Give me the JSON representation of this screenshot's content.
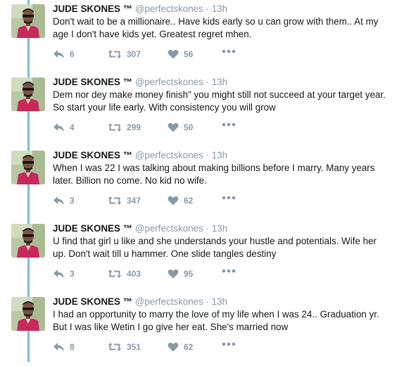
{
  "colors": {
    "thread_line": "#7fb8de",
    "meta": "#8899a6",
    "avatar_shirt": "#c8285a"
  },
  "tweets": [
    {
      "name": "JUDE SKONES ™",
      "handle": "@perfectskones",
      "sep": "·",
      "time": "13h",
      "lines": [
        "Don't wait to be a millionaire..  Have kids early so u can grow with them..  At my",
        "age I don't have kids yet.  Greatest regret mhen."
      ],
      "replies": "6",
      "retweets": "307",
      "likes": "56"
    },
    {
      "name": "JUDE SKONES ™",
      "handle": "@perfectskones",
      "sep": "·",
      "time": "13h",
      "lines": [
        "Dem nor dey make money finish\" you might still not succeed at your target year.",
        "So start your life early.  With consistency you will grow"
      ],
      "replies": "4",
      "retweets": "299",
      "likes": "50"
    },
    {
      "name": "JUDE SKONES ™",
      "handle": "@perfectskones",
      "sep": "·",
      "time": "13h",
      "lines": [
        "When I was 22 I was talking about making billions before I marry.  Many years",
        "later.  Billion no come.  No kid no wife."
      ],
      "replies": "3",
      "retweets": "347",
      "likes": "62"
    },
    {
      "name": "JUDE SKONES ™",
      "handle": "@perfectskones",
      "sep": "·",
      "time": "13h",
      "lines": [
        "U find that girl u like and she understands your hustle and potentials.  Wife her",
        "up.   Don't wait till u hammer.  One slide tangles destiny"
      ],
      "replies": "3",
      "retweets": "403",
      "likes": "95"
    },
    {
      "name": "JUDE SKONES ™",
      "handle": "@perfectskones",
      "sep": "·",
      "time": "13h",
      "lines": [
        "I had an opportunity to marry the love of my life when I was 24.. Graduation yr.",
        "But I was like Wetin I go give her eat.  She's married now"
      ],
      "replies": "8",
      "retweets": "351",
      "likes": "62"
    }
  ]
}
